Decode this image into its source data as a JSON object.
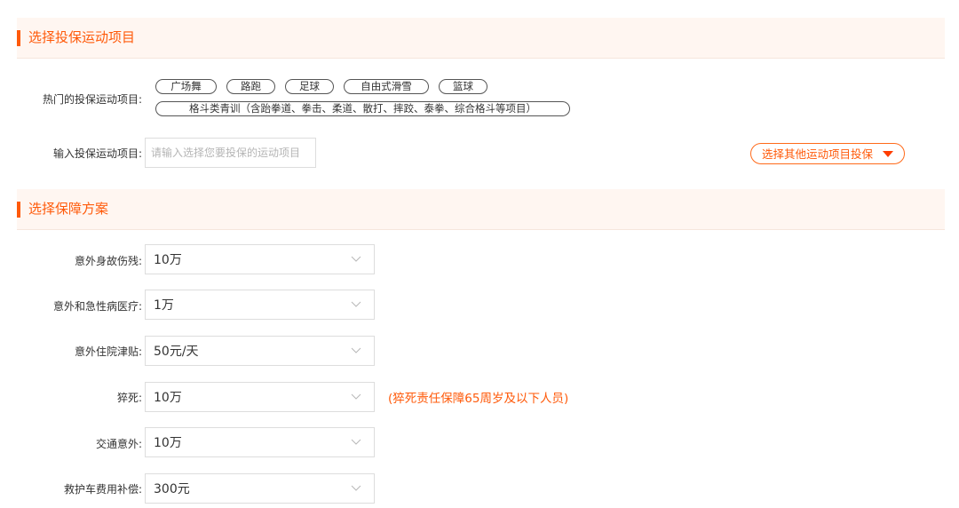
{
  "sport_section": {
    "title": "选择投保运动项目",
    "hot_label": "热门的投保运动项目:",
    "hot_tags": [
      "广场舞",
      "路跑",
      "足球",
      "自由式滑雪",
      "篮球",
      "格斗类青训（含跆拳道、拳击、柔道、散打、摔跤、泰拳、综合格斗等项目）"
    ],
    "input_label": "输入投保运动项目:",
    "input_placeholder": "请输入选择您要投保的运动项目",
    "other_button_label": "选择其他运动项目投保"
  },
  "plan_section": {
    "title": "选择保障方案",
    "rows": [
      {
        "label": "意外身故伤残:",
        "value": "10万"
      },
      {
        "label": "意外和急性病医疗:",
        "value": "1万"
      },
      {
        "label": "意外住院津贴:",
        "value": "50元/天"
      },
      {
        "label": "猝死:",
        "value": "10万"
      },
      {
        "label": "交通意外:",
        "value": "10万"
      },
      {
        "label": "救护车费用补偿:",
        "value": "300元"
      }
    ],
    "sudden_death_note": "(猝死责任保障65周岁及以下人员)"
  },
  "icons": {
    "dropdown": "chevron-down-icon",
    "other_button": "caret-down-icon"
  },
  "colors": {
    "accent": "#ff5a0a",
    "header_bg": "#fff6f1",
    "border": "#dddddd"
  }
}
